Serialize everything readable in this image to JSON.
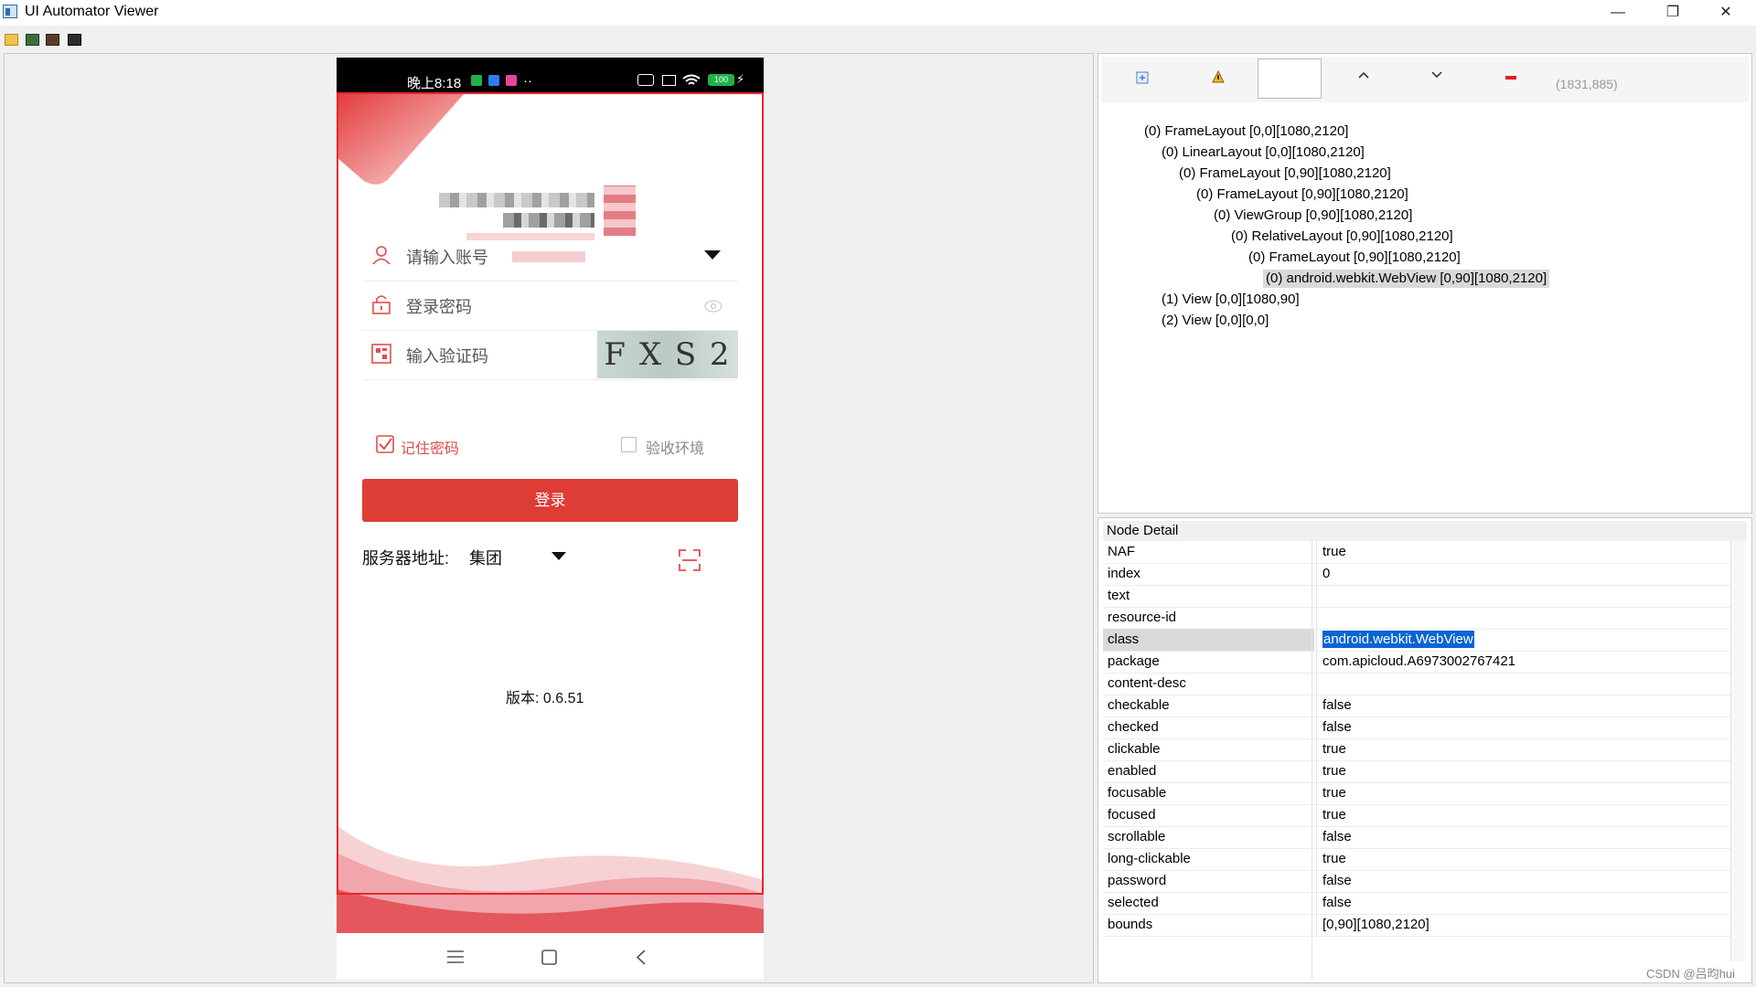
{
  "window": {
    "title": "UI Automator Viewer",
    "controls": {
      "minimize": "—",
      "restore": "❐",
      "close": "✕"
    }
  },
  "toolbar": {
    "icons": [
      "open-folder-icon",
      "device-screenshot-icon",
      "device-screenshot-compressed-icon",
      "save-icon"
    ]
  },
  "phone": {
    "status_time": "晚上8:18",
    "status_dots": "··",
    "battery": "100",
    "account_placeholder": "请输入账号",
    "password_placeholder": "登录密码",
    "captcha_placeholder": "输入验证码",
    "captcha_text": "F X S 2",
    "remember_label": "记住密码",
    "verify_env_label": "验收环境",
    "login_button": "登录",
    "server_label": "服务器地址:",
    "server_value": "集团",
    "version_text": "版本: 0.6.51",
    "remember_checked": true,
    "verify_env_checked": false
  },
  "tree": {
    "coords": "(1831,885)",
    "nodes": [
      {
        "label": "(0) FrameLayout [0,0][1080,2120]",
        "depth": 0
      },
      {
        "label": "(0) LinearLayout [0,0][1080,2120]",
        "depth": 1
      },
      {
        "label": "(0) FrameLayout [0,90][1080,2120]",
        "depth": 2
      },
      {
        "label": "(0) FrameLayout [0,90][1080,2120]",
        "depth": 3
      },
      {
        "label": "(0) ViewGroup [0,90][1080,2120]",
        "depth": 4
      },
      {
        "label": "(0) RelativeLayout [0,90][1080,2120]",
        "depth": 5
      },
      {
        "label": "(0) FrameLayout [0,90][1080,2120]",
        "depth": 6
      },
      {
        "label": "(0) android.webkit.WebView [0,90][1080,2120]",
        "depth": 7,
        "selected": true
      },
      {
        "label": "(1) View [0,0][1080,90]",
        "depth": 1
      },
      {
        "label": "(2) View [0,0][0,0]",
        "depth": 1
      }
    ]
  },
  "detail": {
    "header": "Node Detail",
    "rows": [
      {
        "key": "NAF",
        "value": "true"
      },
      {
        "key": "index",
        "value": "0"
      },
      {
        "key": "text",
        "value": ""
      },
      {
        "key": "resource-id",
        "value": ""
      },
      {
        "key": "class",
        "value": "android.webkit.WebView",
        "selected": true
      },
      {
        "key": "package",
        "value": "com.apicloud.A6973002767421"
      },
      {
        "key": "content-desc",
        "value": ""
      },
      {
        "key": "checkable",
        "value": "false"
      },
      {
        "key": "checked",
        "value": "false"
      },
      {
        "key": "clickable",
        "value": "true"
      },
      {
        "key": "enabled",
        "value": "true"
      },
      {
        "key": "focusable",
        "value": "true"
      },
      {
        "key": "focused",
        "value": "true"
      },
      {
        "key": "scrollable",
        "value": "false"
      },
      {
        "key": "long-clickable",
        "value": "true"
      },
      {
        "key": "password",
        "value": "false"
      },
      {
        "key": "selected",
        "value": "false"
      },
      {
        "key": "bounds",
        "value": "[0,90][1080,2120]"
      }
    ]
  },
  "watermark": "CSDN @吕昀hui",
  "colors": {
    "accent_red": "#dd3d35",
    "selection_rect": "#e8262f",
    "selection_blue": "#0a64d4"
  }
}
